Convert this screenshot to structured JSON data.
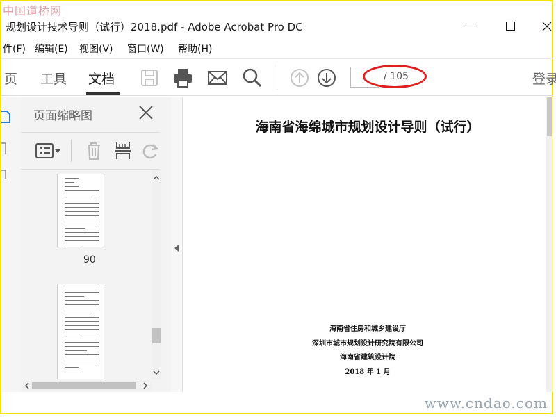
{
  "watermarks": {
    "top": "中国道桥网",
    "bottom": "www.cndao.com"
  },
  "window": {
    "title": "规划设计技术导则（试行）2018.pdf - Adobe Acrobat Pro DC"
  },
  "menu": {
    "items": [
      {
        "label": "件(F)"
      },
      {
        "label": "编辑(E)"
      },
      {
        "label": "视图(V)"
      },
      {
        "label": "窗口(W)"
      },
      {
        "label": "帮助(H)"
      }
    ]
  },
  "toolbar": {
    "tabs": [
      {
        "label": "页"
      },
      {
        "label": "工具"
      },
      {
        "label": "文档",
        "active": true
      }
    ],
    "icons": [
      "save-icon",
      "print-icon",
      "mail-icon",
      "search-icon",
      "page-up-icon",
      "page-down-icon"
    ],
    "page_input_value": "",
    "page_total": "/ 105",
    "login_label": "登录"
  },
  "nav_panel": {
    "title": "页面缩略图",
    "thumbnails": [
      {
        "page_label": "90"
      },
      {
        "page_label": ""
      }
    ]
  },
  "document": {
    "title": "海南省海绵城市规划设计导则（试行）",
    "publishers": [
      "海南省住房和城乡建设厅",
      "深圳市城市规划设计研究院有限公司",
      "海南省建筑设计院"
    ],
    "date": "2018 年 1 月"
  },
  "colors": {
    "frame_border": "#f2e600",
    "highlight_ellipse": "#e02020",
    "panel_background": "#f3f3f3"
  }
}
